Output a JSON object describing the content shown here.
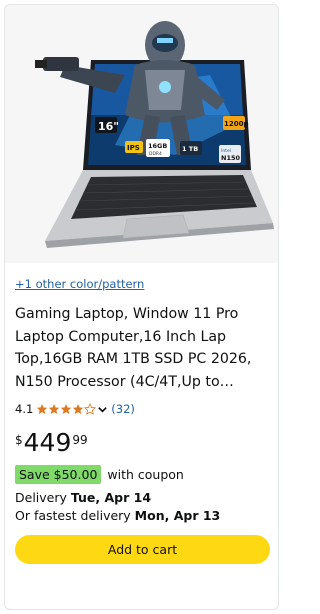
{
  "product": {
    "image_alt": "Gaming laptop with armored robot figure on screen",
    "screen_badges": {
      "size": "16\"",
      "ips": "IPS",
      "ram": "16GB",
      "ram_sub": "DDR4",
      "storage": "1 TB",
      "resolution": "1200p",
      "cpu": "N150",
      "cpu_brand": "Intel"
    },
    "variant_link": "+1 other color/pattern",
    "title": "Gaming Laptop, Window 11 Pro Laptop Computer,16 Inch Lap Top,16GB RAM 1TB SSD PC 2026, N150 Processor (4C/4T,Up to…",
    "rating": {
      "value": "4.1",
      "stars": 4.1,
      "review_count": "(32)"
    },
    "price": {
      "symbol": "$",
      "whole": "449",
      "fraction": "99"
    },
    "coupon": {
      "badge": "Save $50.00",
      "text": "with coupon"
    },
    "delivery": {
      "line1_prefix": "Delivery ",
      "line1_date": "Tue, Apr 14",
      "line2_prefix": "Or fastest delivery ",
      "line2_date": "Mon, Apr 13"
    },
    "cart_button": "Add to cart"
  },
  "colors": {
    "link": "#2162a1",
    "star": "#de7921",
    "coupon_badge": "#7fda69",
    "cart_button": "#ffd814"
  }
}
